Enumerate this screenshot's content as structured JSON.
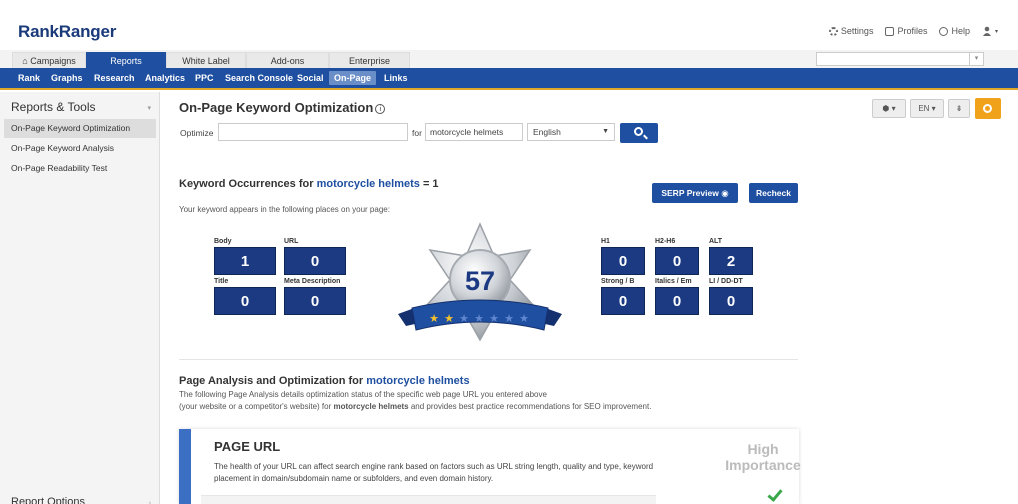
{
  "app": {
    "brand_part1": "Rank",
    "brand_part2": "Ranger"
  },
  "top_links": {
    "settings": "Settings",
    "profiles": "Profiles",
    "help": "Help"
  },
  "main_tabs": [
    {
      "label": "Campaigns",
      "icon": "home-icon"
    },
    {
      "label": "Reports"
    },
    {
      "label": "White Label"
    },
    {
      "label": "Add-ons"
    },
    {
      "label": "Enterprise"
    }
  ],
  "sub_nav": [
    "Rank",
    "Graphs",
    "Research",
    "Analytics",
    "PPC",
    "Search Console",
    "Social",
    "On-Page",
    "Links"
  ],
  "sidebar": {
    "title": "Reports & Tools",
    "items": [
      "On-Page Keyword Optimization",
      "On-Page Keyword Analysis",
      "On-Page Readability Test"
    ],
    "bottom": "Report Options"
  },
  "page": {
    "title": "On-Page Keyword Optimization"
  },
  "optimize_form": {
    "optimize_label": "Optimize",
    "url_value": "",
    "for_label": "for",
    "keyword_value": "motorcycle helmets",
    "language": "English"
  },
  "toolbar": {
    "lang": "EN"
  },
  "occurrences": {
    "title_prefix": "Keyword Occurrences for",
    "keyword": "motorcycle helmets",
    "count_text": "= 1",
    "subtitle": "Your keyword appears in the following places on your page:",
    "serp_preview": "SERP Preview",
    "recheck": "Recheck",
    "score": "57",
    "stars_filled": 2,
    "stars_total": 7,
    "left_metrics": [
      {
        "label": "Body",
        "value": "1"
      },
      {
        "label": "URL",
        "value": "0"
      },
      {
        "label": "Title",
        "value": "0"
      },
      {
        "label": "Meta Description",
        "value": "0"
      }
    ],
    "right_metrics": [
      {
        "label": "H1",
        "value": "0"
      },
      {
        "label": "H2-H6",
        "value": "0"
      },
      {
        "label": "ALT",
        "value": "2"
      },
      {
        "label": "Strong / B",
        "value": "0"
      },
      {
        "label": "Italics / Em",
        "value": "0"
      },
      {
        "label": "LI / DD-DT",
        "value": "0"
      }
    ]
  },
  "analysis": {
    "title_prefix": "Page Analysis and Optimization for",
    "keyword": "motorcycle helmets",
    "line1": "The following Page Analysis details optimization status of the specific web page URL you entered above",
    "line2_a": "(your website or a competitor's website) for",
    "line2_kw": "motorcycle helmets",
    "line2_b": "and provides best practice recommendations for SEO improvement."
  },
  "card": {
    "title": "PAGE URL",
    "text": "The health of your URL can affect search engine rank based on factors such as URL string length, quality and type, keyword placement in domain/subdomain name or subfolders, and even domain history.",
    "importance_1": "High",
    "importance_2": "Importance"
  },
  "colors": {
    "primary": "#1f4fa0",
    "accent": "#f0a21a",
    "box": "#1b3a82"
  }
}
